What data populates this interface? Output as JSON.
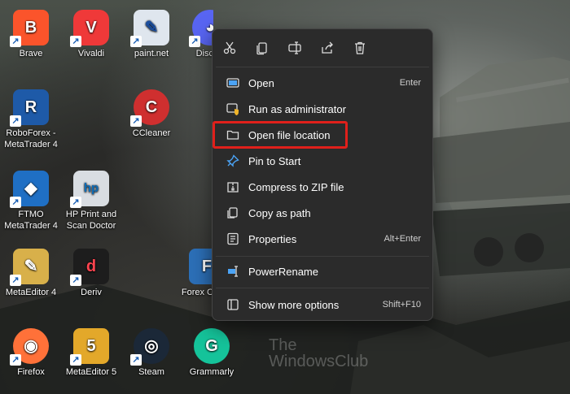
{
  "desktop_icons": [
    {
      "label": "Brave",
      "icon": "brave-icon",
      "color": "#fb542b",
      "glyph": "B"
    },
    {
      "label": "Vivaldi",
      "icon": "vivaldi-icon",
      "color": "#ef3939",
      "glyph": "V"
    },
    {
      "label": "paint.net",
      "icon": "paintnet-icon",
      "color": "#dfe6ee",
      "glyph": "✎"
    },
    {
      "label": "Disc",
      "icon": "discord-icon",
      "color": "#5865f2",
      "glyph": "◕"
    },
    {
      "label": "RoboForex - MetaTrader 4",
      "icon": "metatrader-icon",
      "color": "#1e5aa8",
      "glyph": "R"
    },
    {
      "label": "CCleaner",
      "icon": "ccleaner-icon",
      "color": "#cf2f2f",
      "glyph": "C"
    },
    {
      "label": "FTMO MetaTrader 4",
      "icon": "ftmo-icon",
      "color": "#1f6fc4",
      "glyph": "◆"
    },
    {
      "label": "HP Print and Scan Doctor",
      "icon": "hp-icon",
      "color": "#d9dde2",
      "glyph": "hp"
    },
    {
      "label": "MetaEditor 4",
      "icon": "metaeditor-icon",
      "color": "#d8b04a",
      "glyph": "✎"
    },
    {
      "label": "Deriv",
      "icon": "deriv-icon",
      "color": "#1d1d1d",
      "glyph": "d"
    },
    {
      "label": "Forex C",
      "icon": "forex-icon",
      "color": "#2c6fb7",
      "glyph": "F"
    },
    {
      "label": "Firefox",
      "icon": "firefox-icon",
      "color": "#ff7139",
      "glyph": "◉"
    },
    {
      "label": "MetaEditor 5",
      "icon": "metaeditor5-icon",
      "color": "#e3a82a",
      "glyph": "5"
    },
    {
      "label": "Steam",
      "icon": "steam-icon",
      "color": "#1b2838",
      "glyph": "◎"
    },
    {
      "label": "Grammarly",
      "icon": "grammarly-icon",
      "color": "#15c39a",
      "glyph": "G"
    }
  ],
  "context_menu": {
    "toolbar": [
      "cut-icon",
      "copy-icon",
      "rename-icon",
      "share-icon",
      "delete-icon"
    ],
    "items": [
      {
        "label": "Open",
        "accel": "Enter",
        "icon": "open-icon"
      },
      {
        "label": "Run as administrator",
        "accel": "",
        "icon": "shield-icon"
      },
      {
        "label": "Open file location",
        "accel": "",
        "icon": "folder-icon"
      },
      {
        "label": "Pin to Start",
        "accel": "",
        "icon": "pin-icon"
      },
      {
        "label": "Compress to ZIP file",
        "accel": "",
        "icon": "zip-icon"
      },
      {
        "label": "Copy as path",
        "accel": "",
        "icon": "copy-path-icon"
      },
      {
        "label": "Properties",
        "accel": "Alt+Enter",
        "icon": "properties-icon"
      },
      {
        "label": "PowerRename",
        "accel": "",
        "icon": "powerrename-icon"
      },
      {
        "label": "Show more options",
        "accel": "Shift+F10",
        "icon": "more-options-icon"
      }
    ],
    "highlight_color": "#e0201b"
  },
  "watermark": {
    "line1": "The",
    "line2": "WindowsClub"
  }
}
